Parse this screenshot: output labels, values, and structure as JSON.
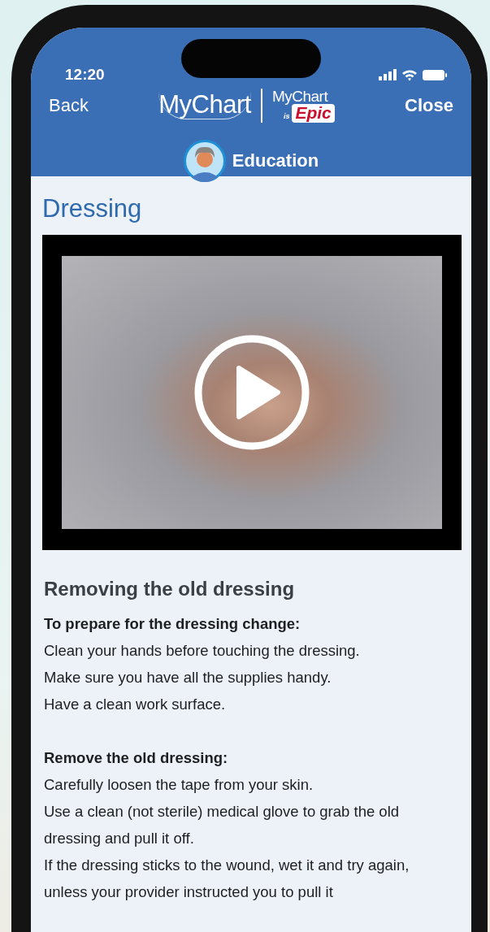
{
  "status_bar": {
    "time": "12:20"
  },
  "nav": {
    "back": "Back",
    "logo": {
      "primary": "MyChart",
      "secondary": "MyChart",
      "tagline_small": "is",
      "tagline_brand": "Epic"
    },
    "close": "Close"
  },
  "section": {
    "title": "Education"
  },
  "page": {
    "title": "Dressing"
  },
  "article": {
    "heading": "Removing the old dressing",
    "blocks": [
      {
        "title": "To prepare for the dressing change:",
        "lines": [
          "Clean your hands before touching the dressing.",
          "Make sure you have all the supplies handy.",
          "Have a clean work surface."
        ]
      },
      {
        "title": "Remove the old dressing:",
        "lines": [
          "Carefully loosen the tape from your skin.",
          "Use a clean (not sterile) medical glove to grab the old dressing and pull it off.",
          "If the dressing sticks to the wound, wet it and try again, unless your provider instructed you to pull it"
        ]
      }
    ]
  }
}
